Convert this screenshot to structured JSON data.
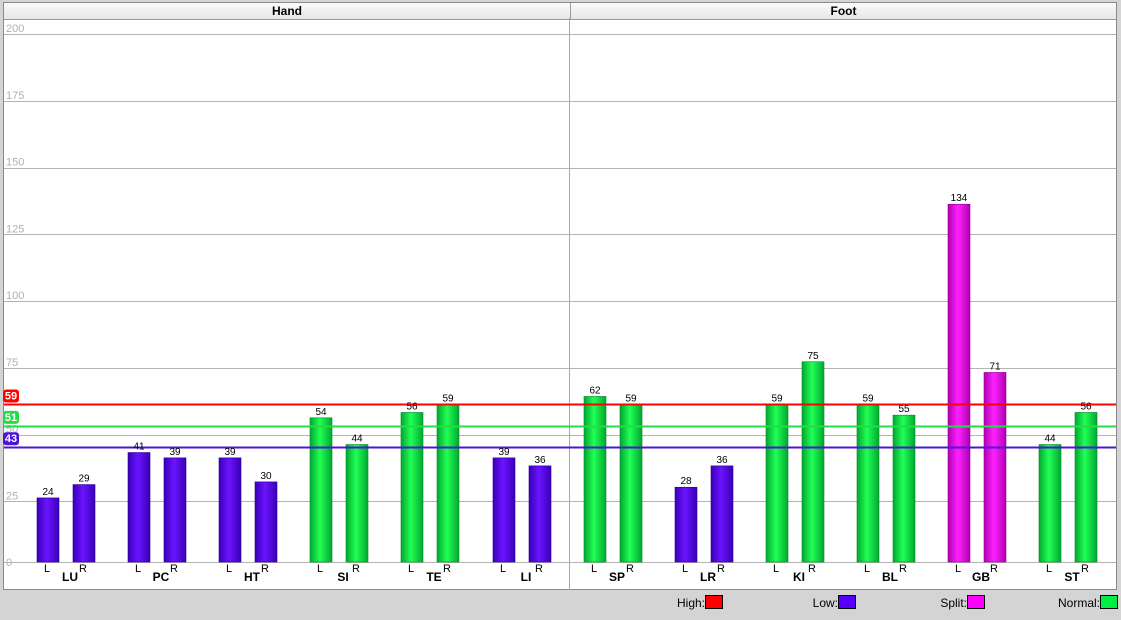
{
  "chart_data": {
    "type": "bar",
    "ylim": [
      0,
      200
    ],
    "yticks": [
      0,
      25,
      50,
      75,
      100,
      125,
      150,
      175,
      200
    ],
    "sections": [
      {
        "name": "Hand",
        "groups": [
          "LU",
          "PC",
          "HT",
          "SI",
          "TE",
          "LI"
        ]
      },
      {
        "name": "Foot",
        "groups": [
          "SP",
          "LR",
          "KI",
          "BL",
          "GB",
          "ST"
        ]
      }
    ],
    "side_labels": [
      "L",
      "R"
    ],
    "groups": [
      {
        "name": "LU",
        "values": [
          24,
          29
        ],
        "status": [
          "low",
          "low"
        ]
      },
      {
        "name": "PC",
        "values": [
          41,
          39
        ],
        "status": [
          "low",
          "low"
        ]
      },
      {
        "name": "HT",
        "values": [
          39,
          30
        ],
        "status": [
          "low",
          "low"
        ]
      },
      {
        "name": "SI",
        "values": [
          54,
          44
        ],
        "status": [
          "normal",
          "normal"
        ]
      },
      {
        "name": "TE",
        "values": [
          56,
          59
        ],
        "status": [
          "normal",
          "normal"
        ]
      },
      {
        "name": "LI",
        "values": [
          39,
          36
        ],
        "status": [
          "low",
          "low"
        ]
      },
      {
        "name": "SP",
        "values": [
          62,
          59
        ],
        "status": [
          "normal",
          "normal"
        ]
      },
      {
        "name": "LR",
        "values": [
          28,
          36
        ],
        "status": [
          "low",
          "low"
        ]
      },
      {
        "name": "KI",
        "values": [
          59,
          75
        ],
        "status": [
          "normal",
          "normal"
        ]
      },
      {
        "name": "BL",
        "values": [
          59,
          55
        ],
        "status": [
          "normal",
          "normal"
        ]
      },
      {
        "name": "GB",
        "values": [
          134,
          71
        ],
        "status": [
          "split",
          "split"
        ]
      },
      {
        "name": "ST",
        "values": [
          44,
          56
        ],
        "status": [
          "normal",
          "normal"
        ]
      }
    ],
    "reference_lines": [
      {
        "name": "High",
        "value": 59,
        "label": "59",
        "color": "#ff0000"
      },
      {
        "name": "Normal",
        "value": 51,
        "label": "51",
        "color": "#22dd44"
      },
      {
        "name": "Low",
        "value": 43,
        "label": "43",
        "color": "#4b14d6"
      }
    ],
    "colors": {
      "high": "#ff0000",
      "low": "#5500ff",
      "split": "#ff00ff",
      "normal": "#00ee44"
    }
  },
  "legend": [
    {
      "key": "high",
      "label": "High:",
      "color": "#ff0000"
    },
    {
      "key": "low",
      "label": "Low:",
      "color": "#5500ff"
    },
    {
      "key": "split",
      "label": "Split:",
      "color": "#ff00ff"
    },
    {
      "key": "normal",
      "label": "Normal:",
      "color": "#00ee44"
    }
  ]
}
